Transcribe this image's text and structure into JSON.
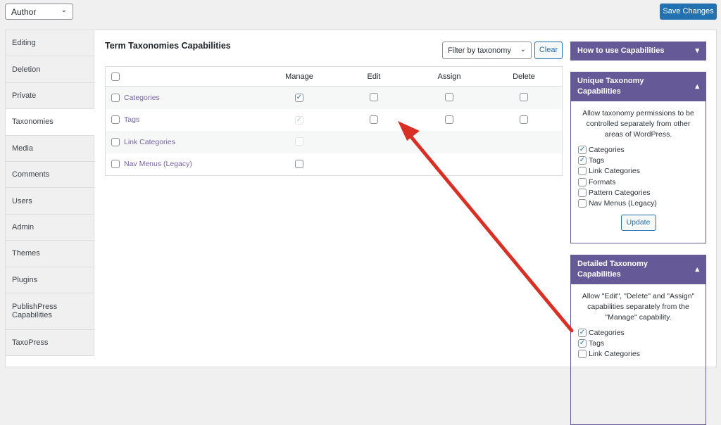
{
  "role_select": {
    "value": "Author"
  },
  "save_label": "Save Changes",
  "tabs": [
    "Editing",
    "Deletion",
    "Private",
    "Taxonomies",
    "Media",
    "Comments",
    "Users",
    "Admin",
    "Themes",
    "Plugins",
    "PublishPress Capabilities",
    "TaxoPress"
  ],
  "active_tab": "Taxonomies",
  "main": {
    "title": "Term Taxonomies Capabilities",
    "filter": "Filter by taxonomy",
    "clear": "Clear",
    "columns": [
      "Manage",
      "Edit",
      "Assign",
      "Delete"
    ],
    "rows": [
      {
        "label": "Categories",
        "manage": "checked",
        "edit": "unchecked",
        "assign": "unchecked",
        "delete": "unchecked"
      },
      {
        "label": "Tags",
        "manage": "checked-disabled",
        "edit": "unchecked",
        "assign": "unchecked",
        "delete": "unchecked"
      },
      {
        "label": "Link Categories",
        "manage": "disabled"
      },
      {
        "label": "Nav Menus (Legacy)",
        "manage": "unchecked"
      }
    ]
  },
  "panels": {
    "how": {
      "title": "How to use Capabilities"
    },
    "unique": {
      "title": "Unique Taxonomy Capabilities",
      "desc": "Allow taxonomy permissions to be controlled separately from other areas of WordPress.",
      "items": [
        {
          "label": "Categories",
          "checked": true
        },
        {
          "label": "Tags",
          "checked": true
        },
        {
          "label": "Link Categories",
          "checked": false
        },
        {
          "label": "Formats",
          "checked": false
        },
        {
          "label": "Pattern Categories",
          "checked": false
        },
        {
          "label": "Nav Menus (Legacy)",
          "checked": false
        }
      ],
      "button": "Update"
    },
    "detailed": {
      "title": "Detailed Taxonomy Capabilities",
      "desc": "Allow \"Edit\", \"Delete\" and \"Assign\" capabilities separately from the \"Manage\" capability.",
      "items": [
        {
          "label": "Categories",
          "checked": true
        },
        {
          "label": "Tags",
          "checked": true
        },
        {
          "label": "Link Categories",
          "checked": false
        }
      ]
    }
  },
  "colors": {
    "accent": "#2271b1",
    "panel": "#655997",
    "arrow": "#d93025"
  }
}
